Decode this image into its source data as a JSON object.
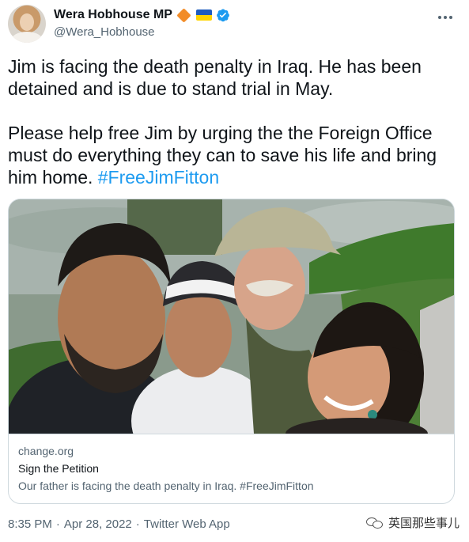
{
  "author": {
    "display_name": "Wera Hobhouse MP",
    "handle": "@Wera_Hobhouse",
    "badges": [
      "orange-diamond",
      "ukraine-flag",
      "verified-check"
    ],
    "colors": {
      "diamond": "#f28c28",
      "flag_blue": "#1d5bbf",
      "flag_yellow": "#ffd400",
      "verified": "#1d9bf0"
    }
  },
  "tweet": {
    "paragraph_1": "Jim is facing the death penalty in Iraq. He has been detained and is due to stand trial in May.",
    "paragraph_2_text": "Please help free Jim by urging the the Foreign Office must do everything they can to save his life and bring him home. ",
    "paragraph_2_hashtag": "#FreeJimFitton"
  },
  "card": {
    "domain": "change.org",
    "title": "Sign the Petition",
    "description": "Our father is facing the death penalty in Iraq. #FreeJimFitton"
  },
  "footer": {
    "time": "8:35 PM",
    "date": "Apr 28, 2022",
    "source": "Twitter Web App",
    "separator": "·"
  },
  "watermark": {
    "text": "英国那些事儿"
  },
  "theme": {
    "link_color": "#1d9bf0",
    "secondary_text": "#536471",
    "border": "#cfd9de"
  }
}
